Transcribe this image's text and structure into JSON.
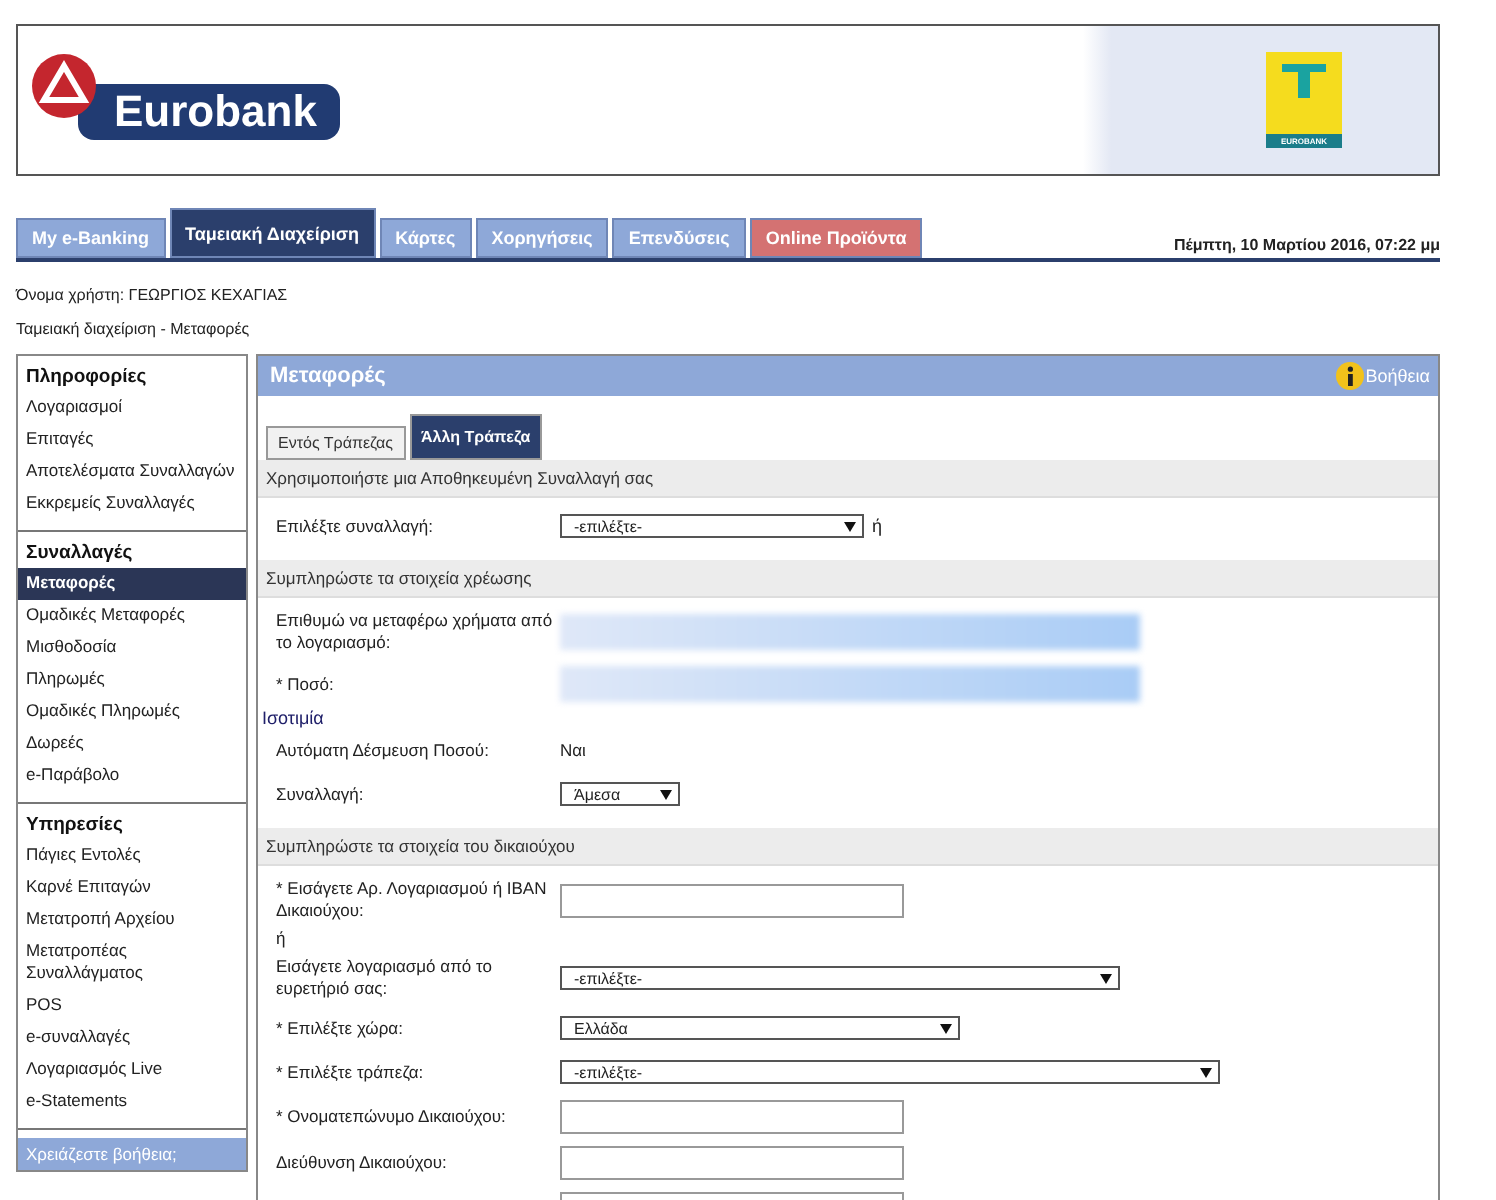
{
  "header": {
    "logo_text": "Eurobank",
    "badge_text": "EUROBANK"
  },
  "tabs": [
    {
      "label": "My e-Banking",
      "selected": false,
      "color": "#8ea8d8"
    },
    {
      "label": "Ταμειακή Διαχείριση",
      "selected": true,
      "color": "#2b3f6c"
    },
    {
      "label": "Κάρτες",
      "selected": false,
      "color": "#8ea8d8"
    },
    {
      "label": "Χορηγήσεις",
      "selected": false,
      "color": "#8ea8d8"
    },
    {
      "label": "Επενδύσεις",
      "selected": false,
      "color": "#8ea8d8"
    },
    {
      "label": "Online Προϊόντα",
      "selected": false,
      "color": "#d47272"
    }
  ],
  "date": "Πέμπτη, 10 Μαρτίου 2016, 07:22 μμ",
  "user_line": "Όνομα χρήστη: ΓΕΩΡΓΙΟΣ ΚΕΧΑΓΙΑΣ",
  "breadcrumb": "Ταμειακή διαχείριση - Μεταφορές",
  "sidebar": {
    "groups": [
      {
        "title": "Πληροφορίες",
        "items": [
          {
            "label": "Λογαριασμοί",
            "selected": false
          },
          {
            "label": "Επιταγές",
            "selected": false
          },
          {
            "label": "Αποτελέσματα Συναλλαγών",
            "selected": false
          },
          {
            "label": "Εκκρεμείς Συναλλαγές",
            "selected": false
          }
        ]
      },
      {
        "title": "Συναλλαγές",
        "items": [
          {
            "label": "Μεταφορές",
            "selected": true
          },
          {
            "label": "Ομαδικές Μεταφορές",
            "selected": false
          },
          {
            "label": "Μισθοδοσία",
            "selected": false
          },
          {
            "label": "Πληρωμές",
            "selected": false
          },
          {
            "label": "Ομαδικές Πληρωμές",
            "selected": false
          },
          {
            "label": "Δωρεές",
            "selected": false
          },
          {
            "label": "e-Παράβολο",
            "selected": false
          }
        ]
      },
      {
        "title": "Υπηρεσίες",
        "items": [
          {
            "label": "Πάγιες Εντολές",
            "selected": false
          },
          {
            "label": "Καρνέ Επιταγών",
            "selected": false
          },
          {
            "label": "Μετατροπή Αρχείου",
            "selected": false
          },
          {
            "label": "Μετατροπέας Συναλλάγματος",
            "selected": false
          },
          {
            "label": "POS",
            "selected": false
          },
          {
            "label": "e-συναλλαγές",
            "selected": false
          },
          {
            "label": "Λογαριασμός Live",
            "selected": false
          },
          {
            "label": "e-Statements",
            "selected": false
          }
        ]
      }
    ],
    "help": "Χρειάζεστε βοήθεια;"
  },
  "panel": {
    "title": "Μεταφορές",
    "help_link": "Βοήθεια",
    "tabs": [
      {
        "label": "Εντός Τράπεζας",
        "selected": false
      },
      {
        "label": "Άλλη Τράπεζα",
        "selected": true
      }
    ],
    "sections": [
      {
        "title": "Χρησιμοποιήστε μια Αποθηκευμένη Συναλλαγή σας",
        "rows": [
          {
            "kind": "select",
            "label": "Επιλέξτε συναλλαγή:",
            "value": "-επιλέξτε-",
            "suffix": "ή"
          }
        ]
      },
      {
        "title": "Συμπληρώστε τα στοιχεία χρέωσης",
        "rows": [
          {
            "kind": "masked",
            "label": "Επιθυμώ να μεταφέρω χρήματα από το λογαριασμό:"
          },
          {
            "kind": "masked",
            "label": "* Ποσό:"
          },
          {
            "kind": "link",
            "label": "Ισοτιμία"
          },
          {
            "kind": "text",
            "label": "Αυτόματη Δέσμευση Ποσού:",
            "value": "Ναι"
          },
          {
            "kind": "select",
            "label": "Συναλλαγή:",
            "value": "Άμεσα"
          }
        ]
      },
      {
        "title": "Συμπληρώστε τα στοιχεία του δικαιούχου",
        "rows": [
          {
            "kind": "input",
            "label": "* Εισάγετε Αρ. Λογαριασμού ή IBAN Δικαιούχου:"
          },
          {
            "kind": "note",
            "label": "ή"
          },
          {
            "kind": "select",
            "label": "Εισάγετε λογαριασμό από το ευρετήριό σας:",
            "value": "-επιλέξτε-"
          },
          {
            "kind": "select",
            "label": "* Επιλέξτε χώρα:",
            "value": "Ελλάδα"
          },
          {
            "kind": "select",
            "label": "* Επιλέξτε τράπεζα:",
            "value": "-επιλέξτε-"
          },
          {
            "kind": "input",
            "label": "* Ονοματεπώνυμο Δικαιούχου:"
          },
          {
            "kind": "input",
            "label": "Διεύθυνση Δικαιούχου:"
          },
          {
            "kind": "input"
          }
        ]
      }
    ]
  }
}
